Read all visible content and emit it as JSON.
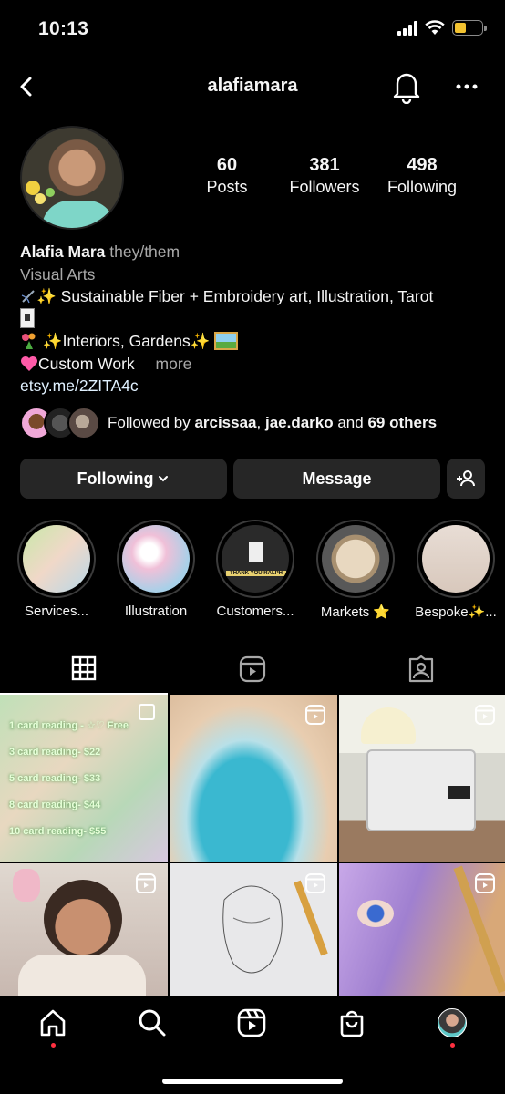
{
  "status_bar": {
    "time": "10:13",
    "battery_color": "#f2c230"
  },
  "header": {
    "username": "alafiamara"
  },
  "stats": [
    {
      "number": "60",
      "label": "Posts"
    },
    {
      "number": "381",
      "label": "Followers"
    },
    {
      "number": "498",
      "label": "Following"
    }
  ],
  "bio": {
    "name": "Alafia Mara",
    "pronouns": "they/them",
    "category": "Visual Arts",
    "line1": "✨ Sustainable Fiber + Embroidery art, Illustration, Tarot",
    "line1_icon": "needle-icon",
    "line2_icon": "tarot-card-icon",
    "line3": " ✨Interiors, Gardens✨ ",
    "line3_icons": [
      "flower-bouquet-icon",
      "picture-frame-icon"
    ],
    "line4": "Custom Work",
    "line4_icon": "heart-icon",
    "more": "more",
    "link": "etsy.me/2ZITA4c"
  },
  "followed_by": {
    "prefix": "Followed by ",
    "user1": "arcissaa",
    "separator": ", ",
    "user2": "jae.darko",
    "and": " and ",
    "others": "69 others"
  },
  "buttons": {
    "following": "Following",
    "message": "Message"
  },
  "highlights": [
    {
      "label": "Services..."
    },
    {
      "label": "Illustration"
    },
    {
      "label": "Customers..."
    },
    {
      "label": "Markets ⭐"
    },
    {
      "label": "Bespoke✨..."
    }
  ],
  "highlight_inner_text": "THANK YOU RALPH",
  "tabs": [
    "grid-icon",
    "reels-icon",
    "tagged-icon"
  ],
  "grid_post1_lines": [
    "1 card reading - ☆♡ Free",
    "3 card reading- $22",
    "5 card reading- $33",
    "8 card reading- $44",
    "10 card reading- $55"
  ],
  "bottom_nav": [
    "home-icon",
    "search-icon",
    "reels-icon",
    "shop-icon",
    "profile-avatar"
  ],
  "colors": {
    "background": "#000000",
    "button": "#262626",
    "notification_dot": "#ff3040"
  }
}
